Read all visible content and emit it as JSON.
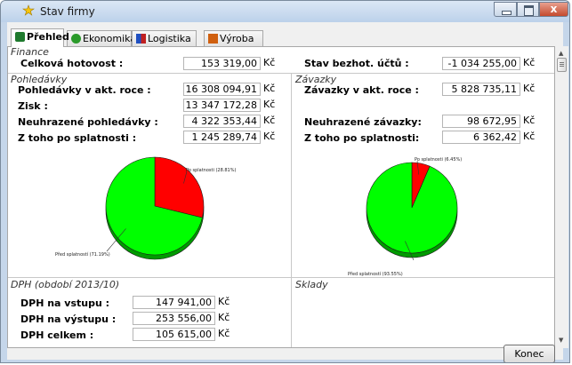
{
  "window": {
    "title": "Stav firmy",
    "close_glyph": "x"
  },
  "tabs": [
    {
      "label": "Přehled",
      "icon": "overview-icon",
      "icon_color": "#1f7a2e"
    },
    {
      "label": "Ekonomika",
      "icon": "economics-icon",
      "icon_color": "#2a9a2a"
    },
    {
      "label": "Logistika",
      "icon": "logistics-icon",
      "icon_color": "#2050c0"
    },
    {
      "label": "Výroba",
      "icon": "production-icon",
      "icon_color": "#d06010"
    }
  ],
  "finance": {
    "heading": "Finance",
    "hotovost_label": "Celková hotovost :",
    "hotovost_value": "153 319,00",
    "ucty_label": "Stav bezhot. účtů :",
    "ucty_value": "-1 034 255,00"
  },
  "currency": "Kč",
  "pohledavky": {
    "heading": "Pohledávky",
    "rows": [
      {
        "label": "Pohledávky v akt. roce :",
        "value": "16 308 094,91"
      },
      {
        "label": "Zisk :",
        "value": "13 347 172,28"
      },
      {
        "label": "Neuhrazené pohledávky :",
        "value": "4 322 353,44"
      },
      {
        "label": "Z toho po splatnosti :",
        "value": "1 245 289,74"
      }
    ],
    "pie": {
      "slices": [
        {
          "label": "Po splatnosti (28.81%)",
          "percent": 28.81,
          "color": "#ff0000"
        },
        {
          "label": "Před splatností (71.19%)",
          "percent": 71.19,
          "color": "#00ff00"
        }
      ]
    }
  },
  "zavazky": {
    "heading": "Závazky",
    "rows": [
      {
        "label": "Závazky v akt. roce :",
        "value": "5 828 735,11"
      },
      {
        "label": "Neuhrazené závazky:",
        "value": "98 672,95"
      },
      {
        "label": "Z toho po splatnosti:",
        "value": "6 362,42"
      }
    ],
    "pie": {
      "slices": [
        {
          "label": "Po splatnosti (6.45%)",
          "percent": 6.45,
          "color": "#ff0000"
        },
        {
          "label": "Před splatností (93.55%)",
          "percent": 93.55,
          "color": "#00ff00"
        }
      ]
    }
  },
  "dph": {
    "heading": "DPH (období 2013/10)",
    "rows": [
      {
        "label": "DPH na vstupu :",
        "value": "147 941,00"
      },
      {
        "label": "DPH na výstupu :",
        "value": "253 556,00"
      },
      {
        "label": "DPH celkem :",
        "value": "105 615,00"
      }
    ]
  },
  "sklady": {
    "heading": "Sklady"
  },
  "buttons": {
    "close_label": "Konec"
  }
}
